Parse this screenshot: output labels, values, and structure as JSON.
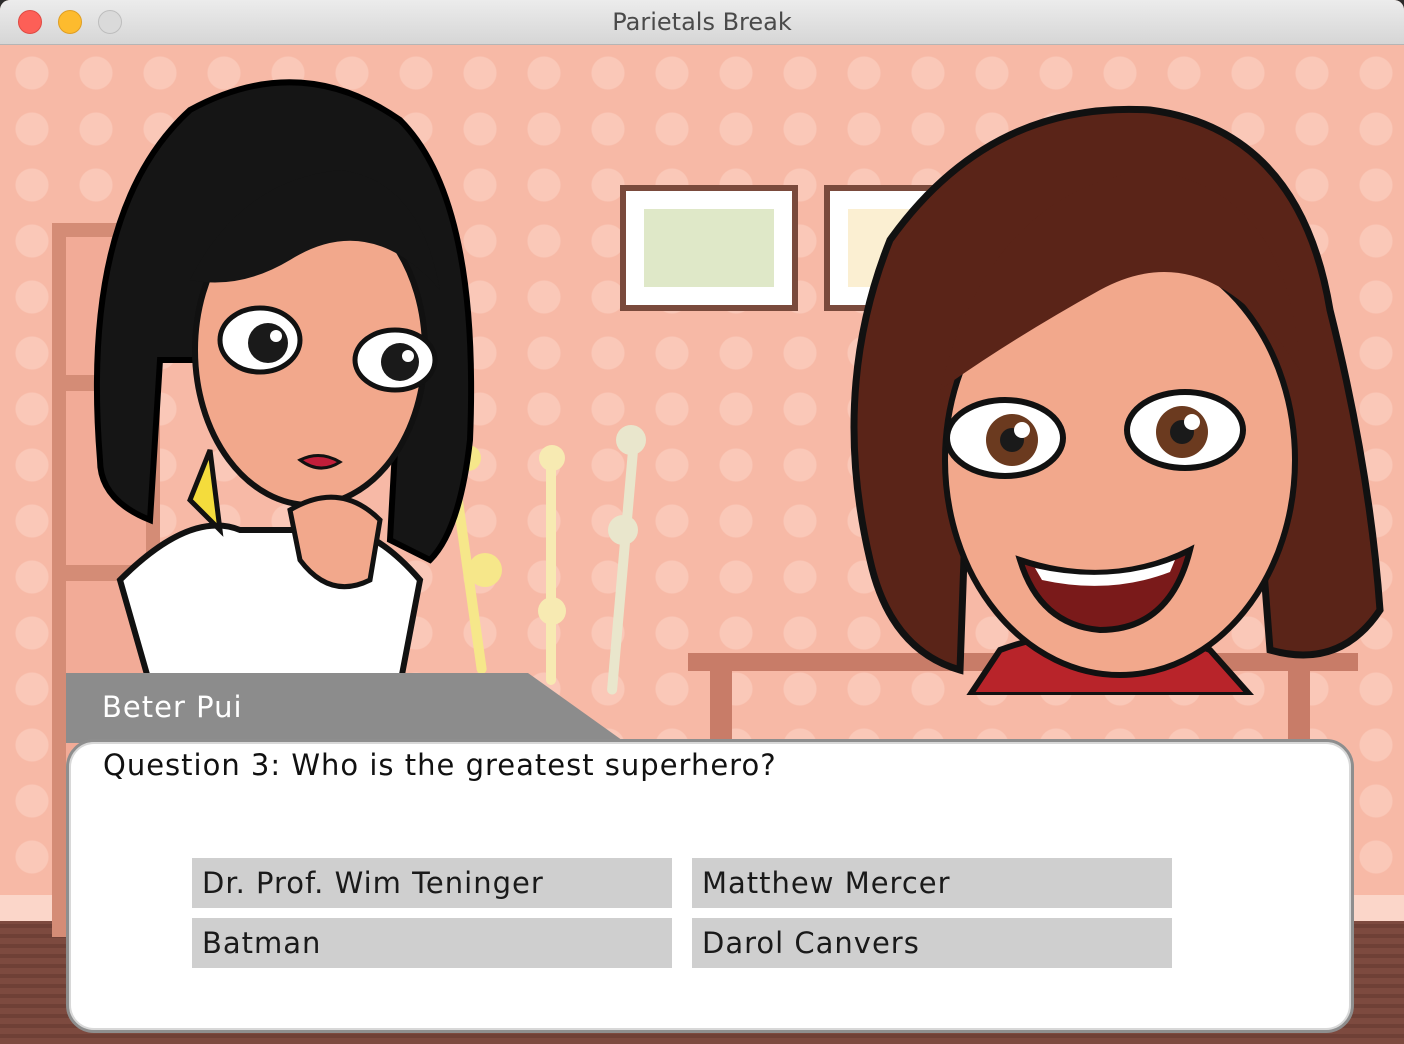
{
  "window": {
    "title": "Parietals Break"
  },
  "dialog": {
    "speaker": "Beter Pui",
    "question": "Question 3: Who is the greatest superhero?",
    "answers": [
      {
        "label": "Dr. Prof. Wim Teninger"
      },
      {
        "label": "Matthew Mercer"
      },
      {
        "label": "Batman"
      },
      {
        "label": "Darol Canvers"
      }
    ]
  },
  "scene": {
    "characters": [
      {
        "name": "left-character",
        "hair": "#151515",
        "skin": "#f2a88c"
      },
      {
        "name": "right-character",
        "hair": "#5a2418",
        "skin": "#f2a88c"
      }
    ]
  }
}
